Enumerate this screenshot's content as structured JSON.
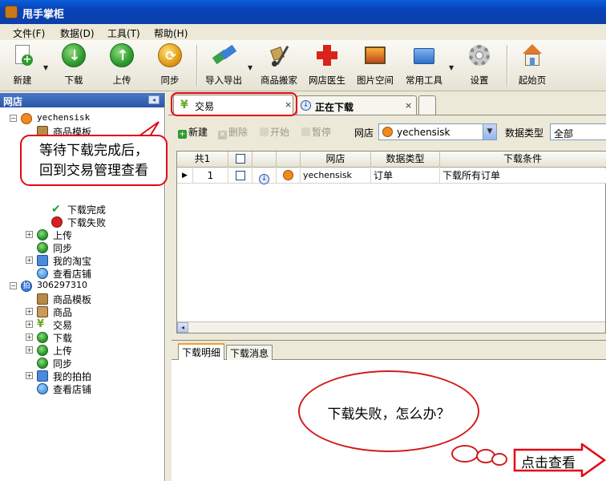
{
  "window": {
    "title": "甩手掌柜"
  },
  "menu": [
    "文件(F)",
    "数据(D)",
    "工具(T)",
    "帮助(H)"
  ],
  "toolbar": {
    "items": [
      {
        "label": "新建",
        "icon": "new-doc-icon"
      },
      {
        "label": "下载",
        "icon": "download-icon"
      },
      {
        "label": "上传",
        "icon": "upload-icon"
      },
      {
        "label": "同步",
        "icon": "sync-icon"
      },
      {
        "label": "导入导出",
        "icon": "import-export-icon"
      },
      {
        "label": "商品搬家",
        "icon": "hand-truck-icon"
      },
      {
        "label": "网店医生",
        "icon": "red-cross-icon"
      },
      {
        "label": "图片空间",
        "icon": "picture-icon"
      },
      {
        "label": "常用工具",
        "icon": "folder-tools-icon"
      },
      {
        "label": "设置",
        "icon": "gear-icon"
      },
      {
        "label": "起始页",
        "icon": "home-icon"
      }
    ]
  },
  "left_panel": {
    "title": "网店",
    "tree": [
      {
        "label": "yechensisk",
        "level": 0,
        "expander": "⊟"
      },
      {
        "label": "商品模板",
        "level": 1
      },
      {
        "label": "下载完成",
        "level": 2
      },
      {
        "label": "下载失败",
        "level": 2
      },
      {
        "label": "上传",
        "level": 1,
        "expander": "⊞"
      },
      {
        "label": "同步",
        "level": 1
      },
      {
        "label": "我的淘宝",
        "level": 1,
        "expander": "⊞"
      },
      {
        "label": "查看店铺",
        "level": 1
      },
      {
        "label": "306297310",
        "level": 0,
        "expander": "⊟"
      },
      {
        "label": "商品模板",
        "level": 1
      },
      {
        "label": "商品",
        "level": 1,
        "expander": "⊞"
      },
      {
        "label": "交易",
        "level": 1,
        "expander": "⊞"
      },
      {
        "label": "下载",
        "level": 1,
        "expander": "⊞"
      },
      {
        "label": "上传",
        "level": 1,
        "expander": "⊞"
      },
      {
        "label": "同步",
        "level": 1
      },
      {
        "label": "我的拍拍",
        "level": 1,
        "expander": "⊞"
      },
      {
        "label": "查看店铺",
        "level": 1
      }
    ]
  },
  "tabs": [
    {
      "label": "交易",
      "close": "×",
      "active": true
    },
    {
      "label": "正在下载",
      "close": "×",
      "active": false
    }
  ],
  "sub_toolbar": {
    "new_label": "新建",
    "delete_label": "删除",
    "start_label": "开始",
    "pause_label": "暂停",
    "shop_label": "网店",
    "shop_value": "yechensisk",
    "type_label": "数据类型",
    "type_value": "全部"
  },
  "grid": {
    "columns": [
      "共1",
      "",
      "",
      "",
      "网店",
      "数据类型",
      "下载条件"
    ],
    "rows": [
      {
        "marker": "▶",
        "index": "1",
        "shop": "yechensisk",
        "type": "订单",
        "condition": "下载所有订单"
      }
    ]
  },
  "bottom_tabs": [
    "下载明细",
    "下载消息"
  ],
  "callouts": {
    "top_text_line1": "等待下载完成后，",
    "top_text_line2": "回到交易管理查看",
    "bubble_text": "下载失败，怎么办？",
    "link_text": "点击查看"
  },
  "colors": {
    "highlight_red": "#e30613",
    "title_blue": "#0842b8",
    "green_icon": "#2d9a2d",
    "orange_icon": "#e39a16"
  }
}
